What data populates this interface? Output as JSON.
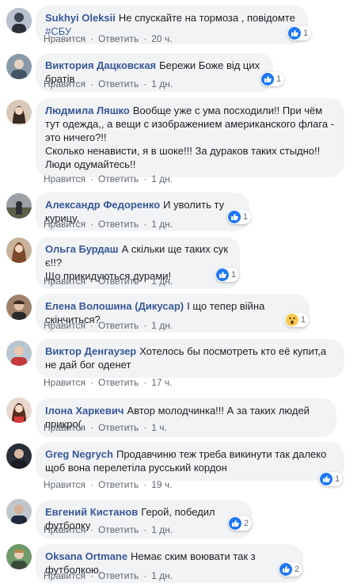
{
  "actions": {
    "like": "Нравится",
    "reply": "Ответить",
    "sep": "·"
  },
  "colors": {
    "author": "#385898",
    "bubble": "#f2f3f5",
    "like": "#2078f4",
    "wow": "#f7c84d"
  },
  "comments": [
    {
      "author": "Sukhyi Oleksii",
      "text": "Не спускайте на тормоза , повідомте ",
      "hashtag": "#СБУ",
      "time": "20 ч.",
      "reaction_icon": "like-icon",
      "reaction_count": "1"
    },
    {
      "author": "Виктория Дацковская",
      "text": "Бережи Боже від цих братів",
      "time": "1 дн.",
      "reaction_icon": "like-icon",
      "reaction_count": "1"
    },
    {
      "author": "Людмила Ляшко",
      "text": "Вообще уже с ума посходили!! При чём тут одежда,, а вещи с изображением американского флага - это ничего?!!",
      "text2": "Сколько ненависти, я в шоке!!! За дураков таких стыдно!! Люди одумайтесь!!",
      "time": "1 дн."
    },
    {
      "author": "Александр Федоренко",
      "text": "И уволить ту курицу.",
      "time": "1 дн.",
      "reaction_icon": "like-icon",
      "reaction_count": "1"
    },
    {
      "author": "Ольга Бурдаш",
      "text": "А скільки ще таких сук є!!?",
      "text2": "Що прикидуються дурами!",
      "time": "1 дн.",
      "reaction_icon": "like-icon",
      "reaction_count": "1"
    },
    {
      "author": "Елена Волошина (Дикусар)",
      "text": "І що тепер війна скінчиться?",
      "time": "1 дн.",
      "reaction_icon": "wow-icon",
      "reaction_count": "1"
    },
    {
      "author": "Виктор Денгаузер",
      "text": "Хотелось бы посмотреть кто её купит,а не дай бог оденет",
      "time": "17 ч."
    },
    {
      "author": "Ілона Харкевич",
      "text": "Автор молодчинка!!! А за таких людей прикро(",
      "time": "1 ч."
    },
    {
      "author": "Greg Negrych",
      "text": "Продавчиню теж треба викинути так далеко щоб вона перелетіла русський кордон",
      "time": "19 ч.",
      "reaction_icon": "like-icon",
      "reaction_count": "1"
    },
    {
      "author": "Евгений Кистанов",
      "text": "Герой, победил футболку",
      "time": "1 дн.",
      "reaction_icon": "like-icon",
      "reaction_count": "2"
    },
    {
      "author": "Oksana Ortmane",
      "text": "Немає ским воювати так з футболкою.",
      "time": "1 дн.",
      "reaction_icon": "like-icon",
      "reaction_count": "2"
    }
  ]
}
